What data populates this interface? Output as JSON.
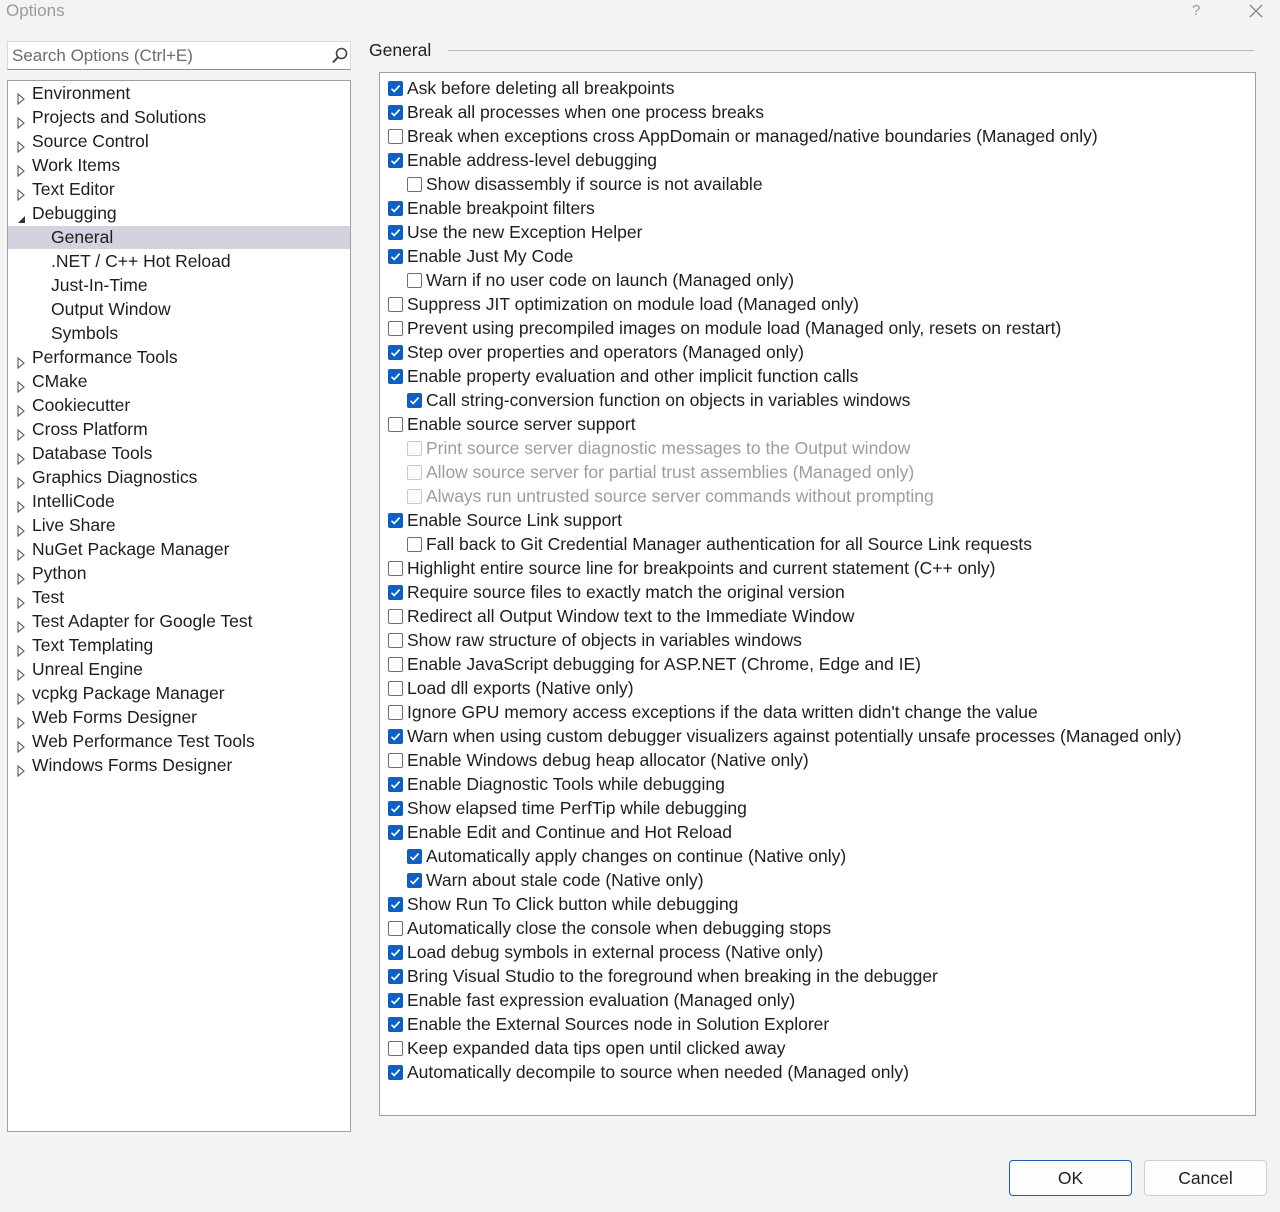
{
  "window": {
    "title": "Options",
    "help_glyph": "?"
  },
  "search": {
    "placeholder": "Search Options (Ctrl+E)"
  },
  "tree": {
    "items": [
      {
        "label": "Environment",
        "level": 0,
        "expander": "collapsed"
      },
      {
        "label": "Projects and Solutions",
        "level": 0,
        "expander": "collapsed"
      },
      {
        "label": "Source Control",
        "level": 0,
        "expander": "collapsed"
      },
      {
        "label": "Work Items",
        "level": 0,
        "expander": "collapsed"
      },
      {
        "label": "Text Editor",
        "level": 0,
        "expander": "collapsed"
      },
      {
        "label": "Debugging",
        "level": 0,
        "expander": "expanded"
      },
      {
        "label": "General",
        "level": 1,
        "expander": "none",
        "selected": true
      },
      {
        "label": ".NET / C++ Hot Reload",
        "level": 1,
        "expander": "none"
      },
      {
        "label": "Just-In-Time",
        "level": 1,
        "expander": "none"
      },
      {
        "label": "Output Window",
        "level": 1,
        "expander": "none"
      },
      {
        "label": "Symbols",
        "level": 1,
        "expander": "none"
      },
      {
        "label": "Performance Tools",
        "level": 0,
        "expander": "collapsed"
      },
      {
        "label": "CMake",
        "level": 0,
        "expander": "collapsed"
      },
      {
        "label": "Cookiecutter",
        "level": 0,
        "expander": "collapsed"
      },
      {
        "label": "Cross Platform",
        "level": 0,
        "expander": "collapsed"
      },
      {
        "label": "Database Tools",
        "level": 0,
        "expander": "collapsed"
      },
      {
        "label": "Graphics Diagnostics",
        "level": 0,
        "expander": "collapsed"
      },
      {
        "label": "IntelliCode",
        "level": 0,
        "expander": "collapsed"
      },
      {
        "label": "Live Share",
        "level": 0,
        "expander": "collapsed"
      },
      {
        "label": "NuGet Package Manager",
        "level": 0,
        "expander": "collapsed"
      },
      {
        "label": "Python",
        "level": 0,
        "expander": "collapsed"
      },
      {
        "label": "Test",
        "level": 0,
        "expander": "collapsed"
      },
      {
        "label": "Test Adapter for Google Test",
        "level": 0,
        "expander": "collapsed"
      },
      {
        "label": "Text Templating",
        "level": 0,
        "expander": "collapsed"
      },
      {
        "label": "Unreal Engine",
        "level": 0,
        "expander": "collapsed"
      },
      {
        "label": "vcpkg Package Manager",
        "level": 0,
        "expander": "collapsed"
      },
      {
        "label": "Web Forms Designer",
        "level": 0,
        "expander": "collapsed"
      },
      {
        "label": "Web Performance Test Tools",
        "level": 0,
        "expander": "collapsed"
      },
      {
        "label": "Windows Forms Designer",
        "level": 0,
        "expander": "collapsed"
      }
    ]
  },
  "group": {
    "header": "General"
  },
  "options": [
    {
      "label": "Ask before deleting all breakpoints",
      "checked": true,
      "indent": 0,
      "enabled": true
    },
    {
      "label": "Break all processes when one process breaks",
      "checked": true,
      "indent": 0,
      "enabled": true
    },
    {
      "label": "Break when exceptions cross AppDomain or managed/native boundaries (Managed only)",
      "checked": false,
      "indent": 0,
      "enabled": true
    },
    {
      "label": "Enable address-level debugging",
      "checked": true,
      "indent": 0,
      "enabled": true
    },
    {
      "label": "Show disassembly if source is not available",
      "checked": false,
      "indent": 1,
      "enabled": true
    },
    {
      "label": "Enable breakpoint filters",
      "checked": true,
      "indent": 0,
      "enabled": true
    },
    {
      "label": "Use the new Exception Helper",
      "checked": true,
      "indent": 0,
      "enabled": true
    },
    {
      "label": "Enable Just My Code",
      "checked": true,
      "indent": 0,
      "enabled": true
    },
    {
      "label": "Warn if no user code on launch (Managed only)",
      "checked": false,
      "indent": 1,
      "enabled": true
    },
    {
      "label": "Suppress JIT optimization on module load (Managed only)",
      "checked": false,
      "indent": 0,
      "enabled": true
    },
    {
      "label": "Prevent using precompiled images on module load (Managed only, resets on restart)",
      "checked": false,
      "indent": 0,
      "enabled": true
    },
    {
      "label": "Step over properties and operators (Managed only)",
      "checked": true,
      "indent": 0,
      "enabled": true
    },
    {
      "label": "Enable property evaluation and other implicit function calls",
      "checked": true,
      "indent": 0,
      "enabled": true
    },
    {
      "label": "Call string-conversion function on objects in variables windows",
      "checked": true,
      "indent": 1,
      "enabled": true
    },
    {
      "label": "Enable source server support",
      "checked": false,
      "indent": 0,
      "enabled": true
    },
    {
      "label": "Print source server diagnostic messages to the Output window",
      "checked": false,
      "indent": 1,
      "enabled": false
    },
    {
      "label": "Allow source server for partial trust assemblies (Managed only)",
      "checked": false,
      "indent": 1,
      "enabled": false
    },
    {
      "label": "Always run untrusted source server commands without prompting",
      "checked": false,
      "indent": 1,
      "enabled": false
    },
    {
      "label": "Enable Source Link support",
      "checked": true,
      "indent": 0,
      "enabled": true
    },
    {
      "label": "Fall back to Git Credential Manager authentication for all Source Link requests",
      "checked": false,
      "indent": 1,
      "enabled": true
    },
    {
      "label": "Highlight entire source line for breakpoints and current statement (C++ only)",
      "checked": false,
      "indent": 0,
      "enabled": true
    },
    {
      "label": "Require source files to exactly match the original version",
      "checked": true,
      "indent": 0,
      "enabled": true
    },
    {
      "label": "Redirect all Output Window text to the Immediate Window",
      "checked": false,
      "indent": 0,
      "enabled": true
    },
    {
      "label": "Show raw structure of objects in variables windows",
      "checked": false,
      "indent": 0,
      "enabled": true
    },
    {
      "label": "Enable JavaScript debugging for ASP.NET (Chrome, Edge and IE)",
      "checked": false,
      "indent": 0,
      "enabled": true
    },
    {
      "label": "Load dll exports (Native only)",
      "checked": false,
      "indent": 0,
      "enabled": true
    },
    {
      "label": "Ignore GPU memory access exceptions if the data written didn't change the value",
      "checked": false,
      "indent": 0,
      "enabled": true
    },
    {
      "label": "Warn when using custom debugger visualizers against potentially unsafe processes (Managed only)",
      "checked": true,
      "indent": 0,
      "enabled": true
    },
    {
      "label": "Enable Windows debug heap allocator (Native only)",
      "checked": false,
      "indent": 0,
      "enabled": true
    },
    {
      "label": "Enable Diagnostic Tools while debugging",
      "checked": true,
      "indent": 0,
      "enabled": true
    },
    {
      "label": "Show elapsed time PerfTip while debugging",
      "checked": true,
      "indent": 0,
      "enabled": true
    },
    {
      "label": "Enable Edit and Continue and Hot Reload",
      "checked": true,
      "indent": 0,
      "enabled": true
    },
    {
      "label": "Automatically apply changes on continue (Native only)",
      "checked": true,
      "indent": 1,
      "enabled": true
    },
    {
      "label": "Warn about stale code (Native only)",
      "checked": true,
      "indent": 1,
      "enabled": true
    },
    {
      "label": "Show Run To Click button while debugging",
      "checked": true,
      "indent": 0,
      "enabled": true
    },
    {
      "label": "Automatically close the console when debugging stops",
      "checked": false,
      "indent": 0,
      "enabled": true
    },
    {
      "label": "Load debug symbols in external process (Native only)",
      "checked": true,
      "indent": 0,
      "enabled": true
    },
    {
      "label": "Bring Visual Studio to the foreground when breaking in the debugger",
      "checked": true,
      "indent": 0,
      "enabled": true
    },
    {
      "label": "Enable fast expression evaluation (Managed only)",
      "checked": true,
      "indent": 0,
      "enabled": true
    },
    {
      "label": "Enable the External Sources node in Solution Explorer",
      "checked": true,
      "indent": 0,
      "enabled": true
    },
    {
      "label": "Keep expanded data tips open until clicked away",
      "checked": false,
      "indent": 0,
      "enabled": true
    },
    {
      "label": "Automatically decompile to source when needed (Managed only)",
      "checked": true,
      "indent": 0,
      "enabled": true
    }
  ],
  "buttons": {
    "ok": "OK",
    "cancel": "Cancel"
  },
  "colors": {
    "accent": "#0e5fc2",
    "selection": "#d3d3df",
    "disabled_text": "#9d9d9d"
  }
}
